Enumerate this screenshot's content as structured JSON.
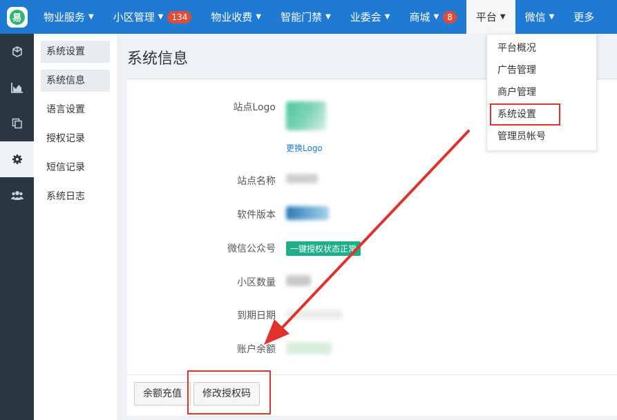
{
  "nav": {
    "logo_char": "易",
    "items": [
      {
        "label": "物业服务",
        "caret": true
      },
      {
        "label": "小区管理",
        "caret": true,
        "badge": "134"
      },
      {
        "label": "物业收费",
        "caret": true
      },
      {
        "label": "智能门禁",
        "caret": true
      },
      {
        "label": "业委会",
        "caret": true
      },
      {
        "label": "商城",
        "caret": true,
        "badge": "8"
      },
      {
        "label": "平台",
        "caret": true,
        "active": true
      },
      {
        "label": "微信",
        "caret": true
      },
      {
        "label": "更多"
      }
    ]
  },
  "dropdown": {
    "items": [
      "平台概况",
      "广告管理",
      "商户管理",
      "系统设置",
      "管理员帐号"
    ]
  },
  "submenu": {
    "items": [
      "系统设置",
      "系统信息",
      "语言设置",
      "授权记录",
      "短信记录",
      "系统日志"
    ]
  },
  "page": {
    "title": "系统信息",
    "rows": {
      "logo_label": "站点Logo",
      "change_logo": "更换Logo",
      "site_name_label": "站点名称",
      "version_label": "软件版本",
      "wechat_label": "微信公众号",
      "wechat_status": "一键授权状态正常",
      "community_label": "小区数量",
      "expire_label": "到期日期",
      "balance_label": "账户余额"
    },
    "buttons": {
      "recharge": "余额充值",
      "modify_code": "修改授权码"
    }
  },
  "colors": {
    "nav_bg": "#1f7ad1",
    "annotation_red": "#e0312d",
    "sidebar_bg": "#2b3643"
  }
}
